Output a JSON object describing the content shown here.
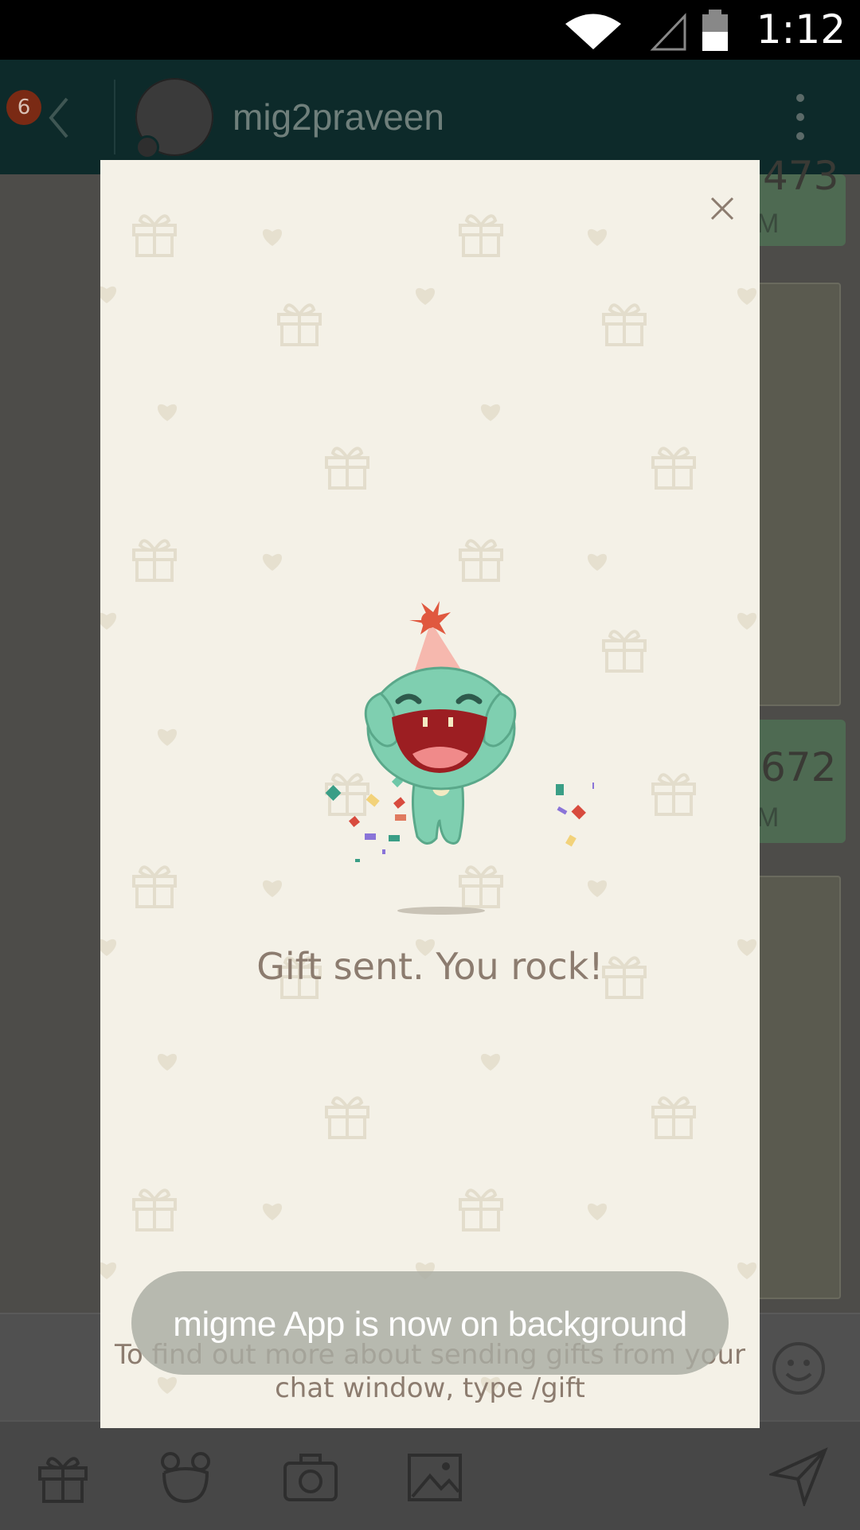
{
  "status_bar": {
    "time": "1:12"
  },
  "header": {
    "unread_badge": "6",
    "chat_name": "mig2praveen"
  },
  "chat": {
    "bubble1_text": "473",
    "bubble1_meta": "M",
    "bubble2_text": "672",
    "bubble2_meta": "M"
  },
  "modal": {
    "message": "Gift sent. You rock!",
    "hint": "To find out more about sending gifts from your chat window, type /gift"
  },
  "toast": {
    "text": "migme App is now on background"
  },
  "colors": {
    "modal_bg": "#f4f1e7",
    "mascot": "#7fcfb0",
    "text": "#8c7c6f"
  }
}
